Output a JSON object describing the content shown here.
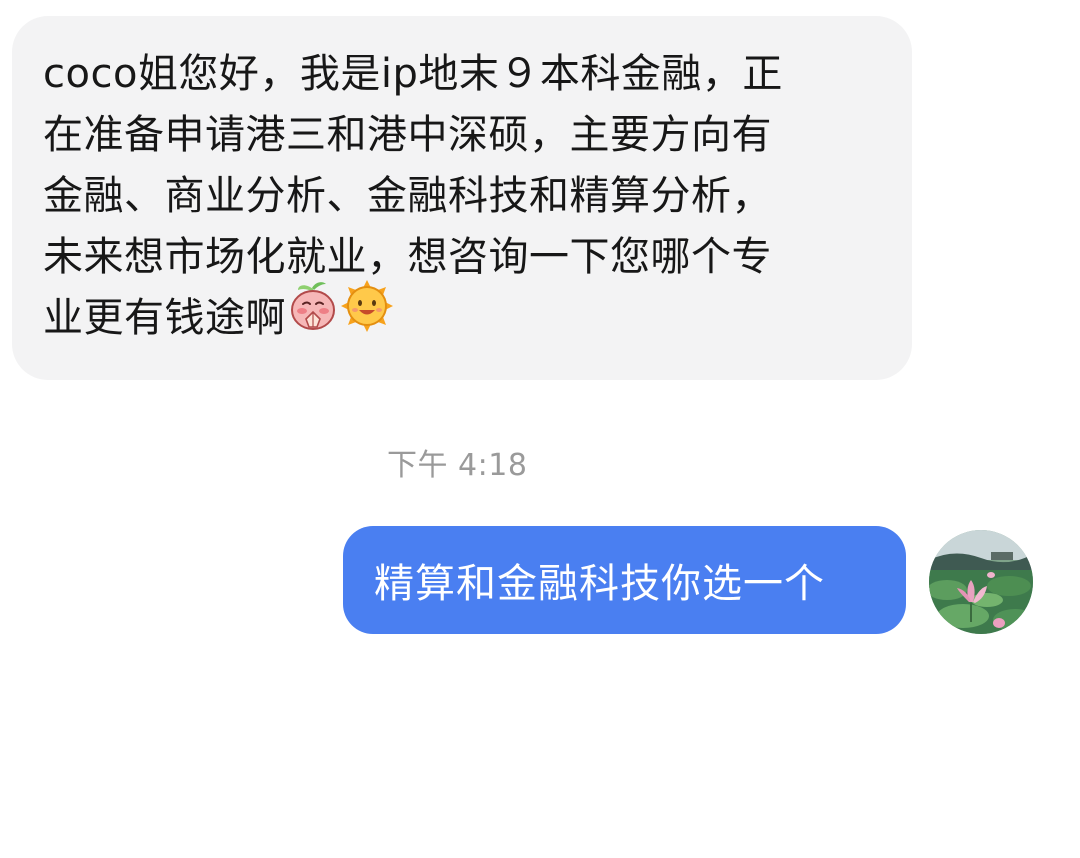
{
  "incoming_message": {
    "lines": [
      "coco姐您好，我是ip地末９本科金融，正",
      "在准备申请港三和港中深硕，主要方向有",
      "金融、商业分析、金融科技和精算分析，",
      "未来想市场化就业，想咨询一下您哪个专",
      "业更有钱途啊"
    ],
    "emojis": [
      "peach-praying-emoji",
      "smiling-sun-emoji"
    ]
  },
  "timestamp": "下午 4:18",
  "outgoing_message": {
    "text": "精算和金融科技你选一个"
  },
  "avatar": {
    "icon": "lotus-pond-avatar"
  },
  "colors": {
    "incoming_bubble": "#f3f3f4",
    "outgoing_bubble": "#4a7ff1",
    "timestamp_text": "#9a9a9a",
    "message_text": "#171717"
  }
}
